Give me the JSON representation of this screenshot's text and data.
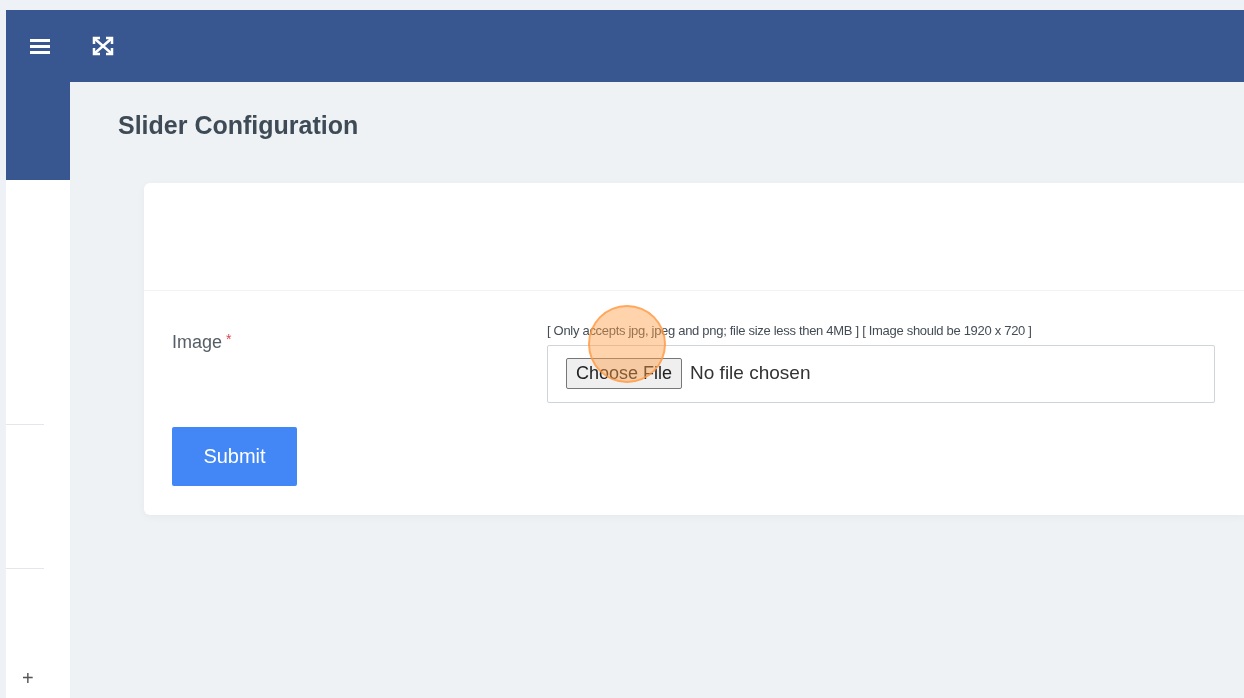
{
  "page": {
    "title": "Slider Configuration"
  },
  "form": {
    "field_label": "Image",
    "required_mark": "*",
    "hint": "[ Only accepts jpg, jpeg and png; file size less then 4MB ] [ Image should be 1920 x 720 ]",
    "file_button": "Choose File",
    "file_status": "No file chosen",
    "submit": "Submit"
  },
  "sidebar": {
    "bottom_icon": "+"
  }
}
